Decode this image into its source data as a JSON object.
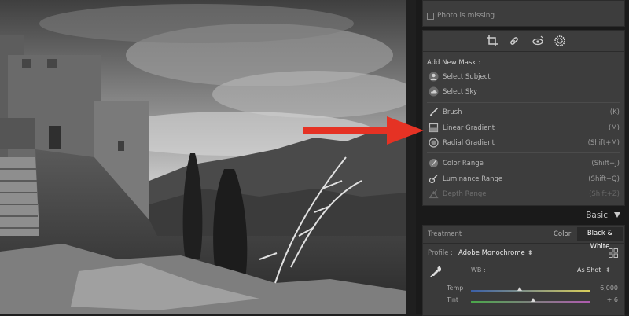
{
  "photo": {
    "alt": "Black and white photo of a hilltop fortress with cypress trees"
  },
  "missing": {
    "text": "Photo is missing"
  },
  "masking": {
    "tools": [
      "crop-icon",
      "healing-icon",
      "red-eye-icon",
      "masking-icon"
    ],
    "add_new_mask": "Add New Mask :",
    "select_subject": "Select Subject",
    "select_sky": "Select Sky",
    "items": [
      {
        "label": "Brush",
        "shortcut": "(K)"
      },
      {
        "label": "Linear Gradient",
        "shortcut": "(M)"
      },
      {
        "label": "Radial Gradient",
        "shortcut": "(Shift+M)"
      },
      {
        "label": "Color Range",
        "shortcut": "(Shift+J)"
      },
      {
        "label": "Luminance Range",
        "shortcut": "(Shift+Q)"
      },
      {
        "label": "Depth Range",
        "shortcut": "(Shift+Z)"
      }
    ]
  },
  "annotation": {
    "arrow_color": "#e53224"
  },
  "basic": {
    "title": "Basic",
    "treatment_label": "Treatment :",
    "color_option": "Color",
    "bw_option": "Black & White",
    "profile_label": "Profile :",
    "profile_value": "Adobe Monochrome",
    "profile_arrows": "⌃",
    "wb_label": "WB :",
    "wb_value": "As Shot",
    "wb_arrows": "÷",
    "temp_label": "Temp",
    "temp_value": "6,000",
    "temp_position": 0.41,
    "tint_label": "Tint",
    "tint_value": "+ 6",
    "tint_position": 0.52
  }
}
